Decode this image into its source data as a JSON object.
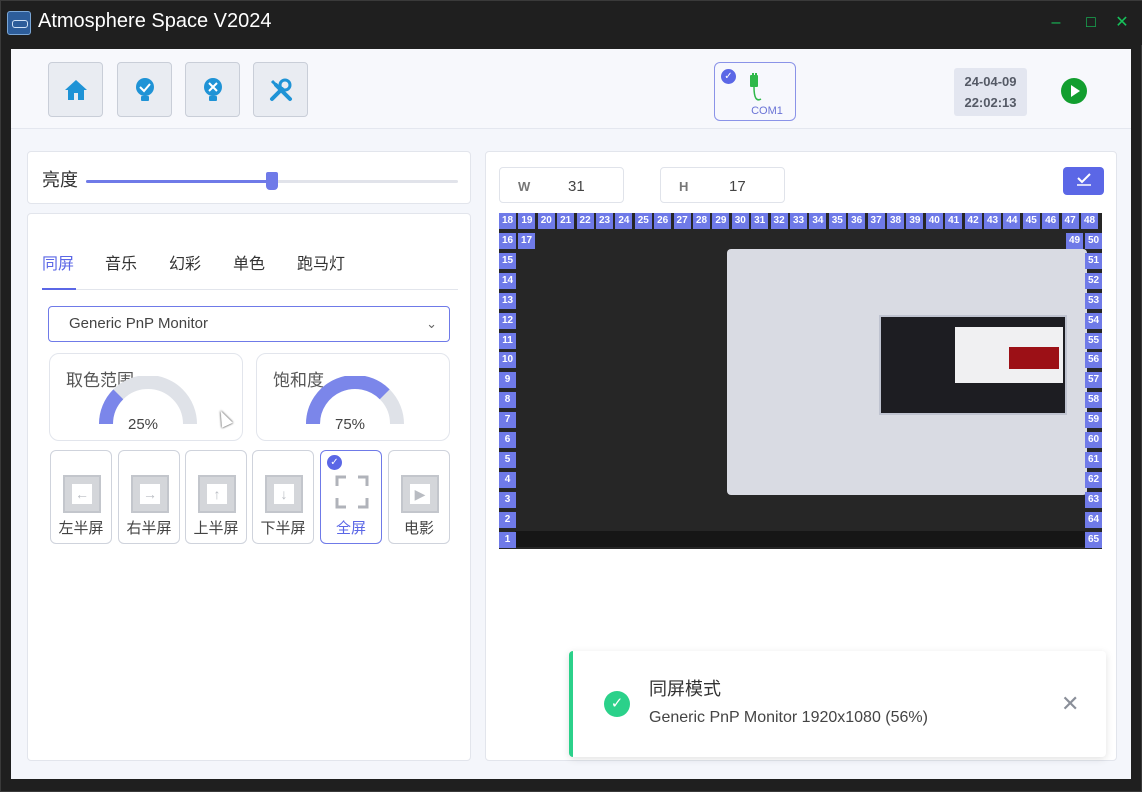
{
  "window": {
    "title": "Atmosphere Space V2024",
    "controls": [
      "–",
      "□",
      "✕"
    ]
  },
  "toolbar": {
    "buttons": [
      {
        "name": "home-icon"
      },
      {
        "name": "lightbulb-on-icon"
      },
      {
        "name": "lightbulb-off-icon"
      },
      {
        "name": "tools-icon"
      }
    ],
    "com_port": "COM1",
    "date": "24-04-09",
    "time": "22:02:13"
  },
  "brightness": {
    "label": "亮度",
    "value_fraction": 0.5
  },
  "tabs": [
    "同屏",
    "音乐",
    "幻彩",
    "单色",
    "跑马灯"
  ],
  "active_tab": 0,
  "monitor_select": {
    "value": "Generic PnP Monitor"
  },
  "gauges": [
    {
      "label": "取色范围",
      "value": "25%",
      "fraction": 0.25
    },
    {
      "label": "饱和度",
      "value": "75%",
      "fraction": 0.75
    }
  ],
  "modes": [
    {
      "label": "左半屏",
      "icon": "left-half-icon",
      "glyph": "←"
    },
    {
      "label": "右半屏",
      "icon": "right-half-icon",
      "glyph": "→"
    },
    {
      "label": "上半屏",
      "icon": "top-half-icon",
      "glyph": "↑"
    },
    {
      "label": "下半屏",
      "icon": "bottom-half-icon",
      "glyph": "↓"
    },
    {
      "label": "全屏",
      "icon": "fullscreen-icon",
      "glyph": ""
    },
    {
      "label": "电影",
      "icon": "movie-icon",
      "glyph": "▶"
    }
  ],
  "selected_mode": 4,
  "dimensions": {
    "w_label": "W",
    "w_value": "31",
    "h_label": "H",
    "h_value": "17"
  },
  "led_numbers": {
    "top": [
      "18",
      "19",
      "20",
      "21",
      "22",
      "23",
      "24",
      "25",
      "26",
      "27",
      "28",
      "29",
      "30",
      "31",
      "32",
      "33",
      "34",
      "35",
      "36",
      "37",
      "38",
      "39",
      "40",
      "41",
      "42",
      "43",
      "44",
      "45",
      "46",
      "47",
      "48"
    ],
    "left": [
      "16",
      "15",
      "14",
      "13",
      "12",
      "11",
      "10",
      "9",
      "8",
      "7",
      "6",
      "5",
      "4",
      "3",
      "2",
      "1"
    ],
    "left_extra": "17",
    "right": [
      "50",
      "51",
      "52",
      "53",
      "54",
      "55",
      "56",
      "57",
      "58",
      "59",
      "60",
      "61",
      "62",
      "63",
      "64",
      "65"
    ],
    "right_extra": "49"
  },
  "toast": {
    "title": "同屏模式",
    "message": "Generic PnP Monitor 1920x1080 (56%)"
  }
}
